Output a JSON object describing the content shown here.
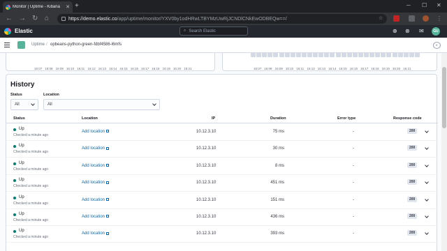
{
  "browser": {
    "tab_title": "Monitor | Uptime - Kibana",
    "url_host": "https://demo.elastic.co",
    "url_path": "/app/uptime/monitor/YXV0by1odHRwLTBYMzUwRjJCNDlCNkEwODBEQw==/"
  },
  "header": {
    "app_name": "Elastic",
    "search_placeholder": "Search Elastic",
    "avatar_initials": "GU"
  },
  "breadcrumb": {
    "root": "Uptime",
    "separator": "/",
    "current": "opbeans-python-green-fdbf4586-l6mfs"
  },
  "chart_ticks": [
    "16:07",
    "16:08",
    "16:09",
    "16:10",
    "16:11",
    "16:12",
    "16:13",
    "16:14",
    "16:15",
    "16:16",
    "16:17",
    "16:18",
    "16:19",
    "16:20",
    "16:21"
  ],
  "history": {
    "title": "History",
    "status_label": "Status",
    "status_value": "All",
    "location_label": "Location",
    "location_value": "All",
    "columns": {
      "status": "Status",
      "location": "Location",
      "ip": "IP",
      "duration": "Duration",
      "error_type": "Error type",
      "response_code": "Response code"
    },
    "rows": [
      {
        "status": "Up",
        "checked": "Checked a minute ago",
        "location": "Add location",
        "ip": "10.12.3.10",
        "duration": "75 ms",
        "error": "-",
        "code": "200"
      },
      {
        "status": "Up",
        "checked": "Checked a minute ago",
        "location": "Add location",
        "ip": "10.12.3.10",
        "duration": "30 ms",
        "error": "-",
        "code": "200"
      },
      {
        "status": "Up",
        "checked": "Checked a minute ago",
        "location": "Add location",
        "ip": "10.12.3.10",
        "duration": "8 ms",
        "error": "-",
        "code": "200"
      },
      {
        "status": "Up",
        "checked": "Checked a minute ago",
        "location": "Add location",
        "ip": "10.12.3.10",
        "duration": "451 ms",
        "error": "-",
        "code": "200"
      },
      {
        "status": "Up",
        "checked": "Checked a minute ago",
        "location": "Add location",
        "ip": "10.12.3.10",
        "duration": "151 ms",
        "error": "-",
        "code": "200"
      },
      {
        "status": "Up",
        "checked": "Checked a minute ago",
        "location": "Add location",
        "ip": "10.12.3.10",
        "duration": "436 ms",
        "error": "-",
        "code": "200"
      },
      {
        "status": "Up",
        "checked": "Checked a minute ago",
        "location": "Add location",
        "ip": "10.12.3.10",
        "duration": "393 ms",
        "error": "-",
        "code": "200"
      }
    ]
  },
  "colors": {
    "status_up": "#017d73",
    "link": "#006bb4",
    "kibana_header": "#25282f"
  }
}
